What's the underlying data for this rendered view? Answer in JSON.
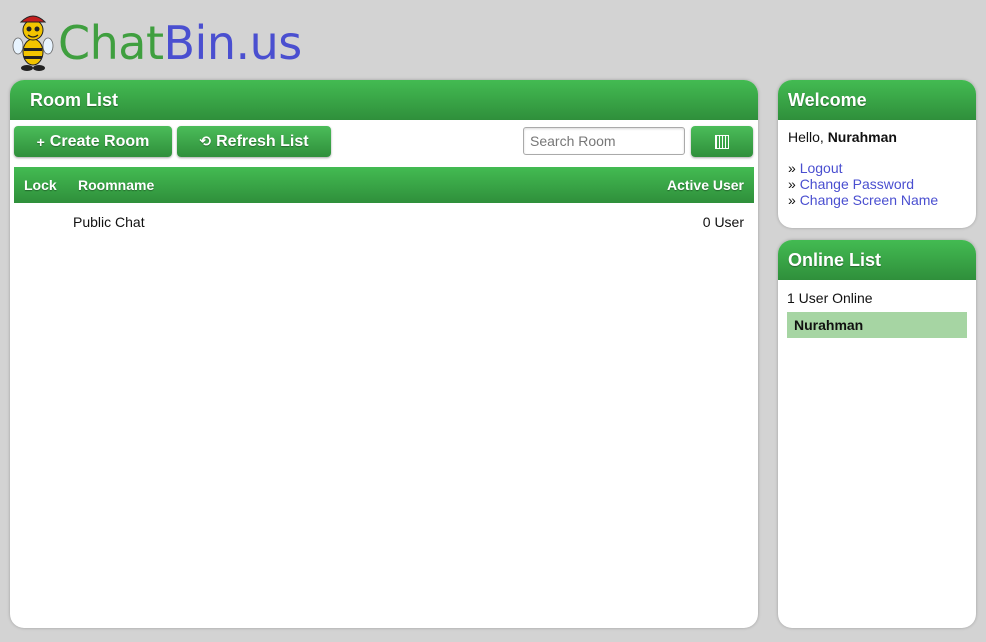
{
  "logo": {
    "part1": "Chat",
    "part2": "Bin.us"
  },
  "room_list": {
    "title": "Room List",
    "create_label": "Create Room",
    "refresh_label": "Refresh List",
    "search_placeholder": "Search Room",
    "columns": {
      "lock": "Lock",
      "name": "Roomname",
      "users": "Active User"
    },
    "rows": [
      {
        "name": "Public Chat",
        "users": "0 User"
      }
    ]
  },
  "welcome": {
    "title": "Welcome",
    "hello": "Hello, ",
    "username": "Nurahman",
    "links": [
      "Logout",
      "Change Password",
      "Change Screen Name"
    ]
  },
  "online": {
    "title": "Online List",
    "count_text": "1 User Online",
    "users": [
      "Nurahman"
    ]
  },
  "colors": {
    "green": "#3cae4a",
    "link_blue": "#4a4fd0",
    "online_highlight": "#a6d5a3",
    "background": "#d3d3d3"
  }
}
